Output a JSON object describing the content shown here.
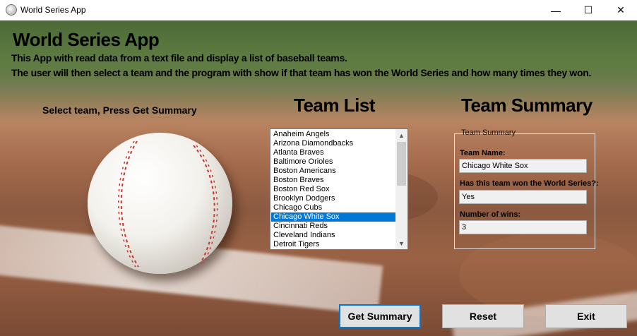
{
  "window": {
    "title": "World Series App",
    "controls": {
      "minimize": "—",
      "maximize": "☐",
      "close": "✕"
    }
  },
  "header": {
    "title": "World Series App",
    "description_line1": "This App with read data from a text file and display a list of baseball teams.",
    "description_line2": "The user will then select a team and the program with show if that team has won the World Series and how many times they won."
  },
  "instructions": "Select team, Press Get Summary",
  "team_list": {
    "heading": "Team List",
    "items": [
      "Anaheim Angels",
      "Arizona Diamondbacks",
      "Atlanta Braves",
      "Baltimore Orioles",
      "Boston Americans",
      "Boston Braves",
      "Boston Red Sox",
      "Brooklyn Dodgers",
      "Chicago Cubs",
      "Chicago White Sox",
      "Cincinnati Reds",
      "Cleveland Indians",
      "Detroit Tigers"
    ],
    "selected": "Chicago White Sox"
  },
  "summary": {
    "heading": "Team Summary",
    "group_label": "Team Summary",
    "team_name_label": "Team Name:",
    "team_name_value": "Chicago White Sox",
    "won_label": "Has this team won the World Series?:",
    "won_value": "Yes",
    "wins_label": "Number of wins:",
    "wins_value": "3"
  },
  "buttons": {
    "get_summary": "Get Summary",
    "reset": "Reset",
    "exit": "Exit"
  },
  "colors": {
    "selection": "#0078d7",
    "default_button_border": "#0078d7"
  }
}
